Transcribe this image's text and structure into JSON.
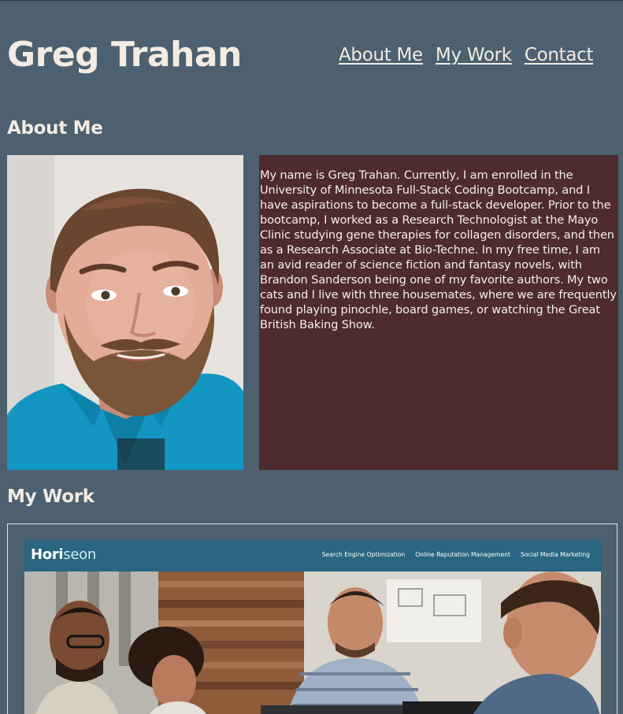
{
  "header": {
    "title": "Greg Trahan",
    "nav": [
      {
        "label": "About Me"
      },
      {
        "label": "My Work"
      },
      {
        "label": "Contact"
      }
    ]
  },
  "about": {
    "heading": "About Me",
    "bio": "My name is Greg Trahan. Currently, I am enrolled in the University of Minnesota Full-Stack Coding Bootcamp, and I have aspirations to become a full-stack developer. Prior to the bootcamp, I worked as a Research Technologist at the Mayo Clinic studying gene therapies for collagen disorders, and then as a Research Associate at Bio-Techne. In my free time, I am an avid reader of science fiction and fantasy novels, with Brandon Sanderson being one of my favorite authors. My two cats and I live with three housemates, where we are frequently found playing pinochle, board games, or watching the Great British Baking Show."
  },
  "work": {
    "heading": "My Work",
    "project": {
      "logo_main": "Hori",
      "logo_accent": "seon",
      "nav": [
        "Search Engine Optimization",
        "Online Reputation Management",
        "Social Media Marketing"
      ]
    }
  },
  "colors": {
    "page_background": "#4c6070",
    "bio_background": "#4d2b2e",
    "text": "#f2ece3",
    "project_header": "#2a6582"
  }
}
